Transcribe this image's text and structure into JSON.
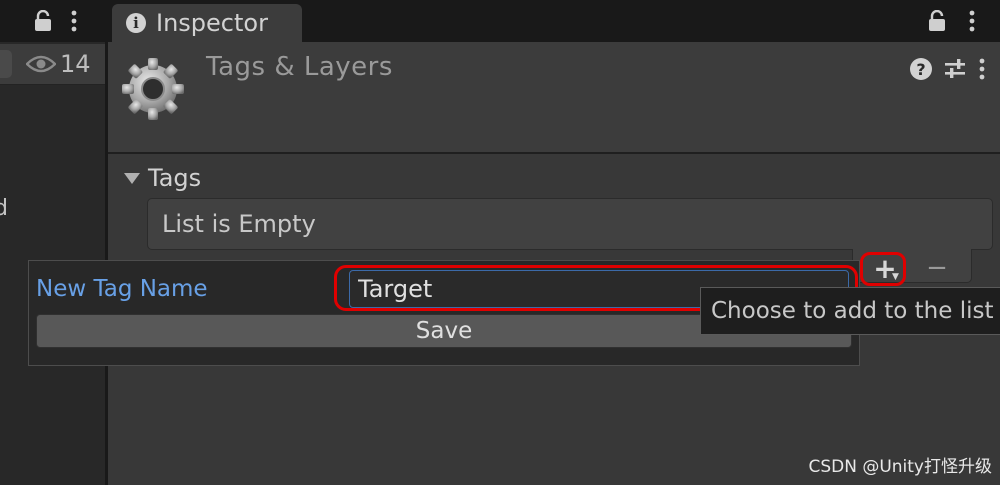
{
  "left_panel": {
    "eye_count": "14",
    "cut_text": "d"
  },
  "tab": {
    "title": "Inspector"
  },
  "header": {
    "title": "Tags & Layers"
  },
  "tags": {
    "foldout_label": "Tags",
    "empty_text": "List is Empty"
  },
  "popup": {
    "label": "New Tag Name",
    "input_value": "Target",
    "save_label": "Save"
  },
  "list_buttons": {
    "add": "+",
    "remove": "−"
  },
  "tooltip": {
    "text": "Choose to add to the list"
  },
  "watermark": {
    "text": "CSDN @Unity打怪升级"
  },
  "colors": {
    "highlight": "#e00000",
    "label_blue": "#68a0e6"
  }
}
